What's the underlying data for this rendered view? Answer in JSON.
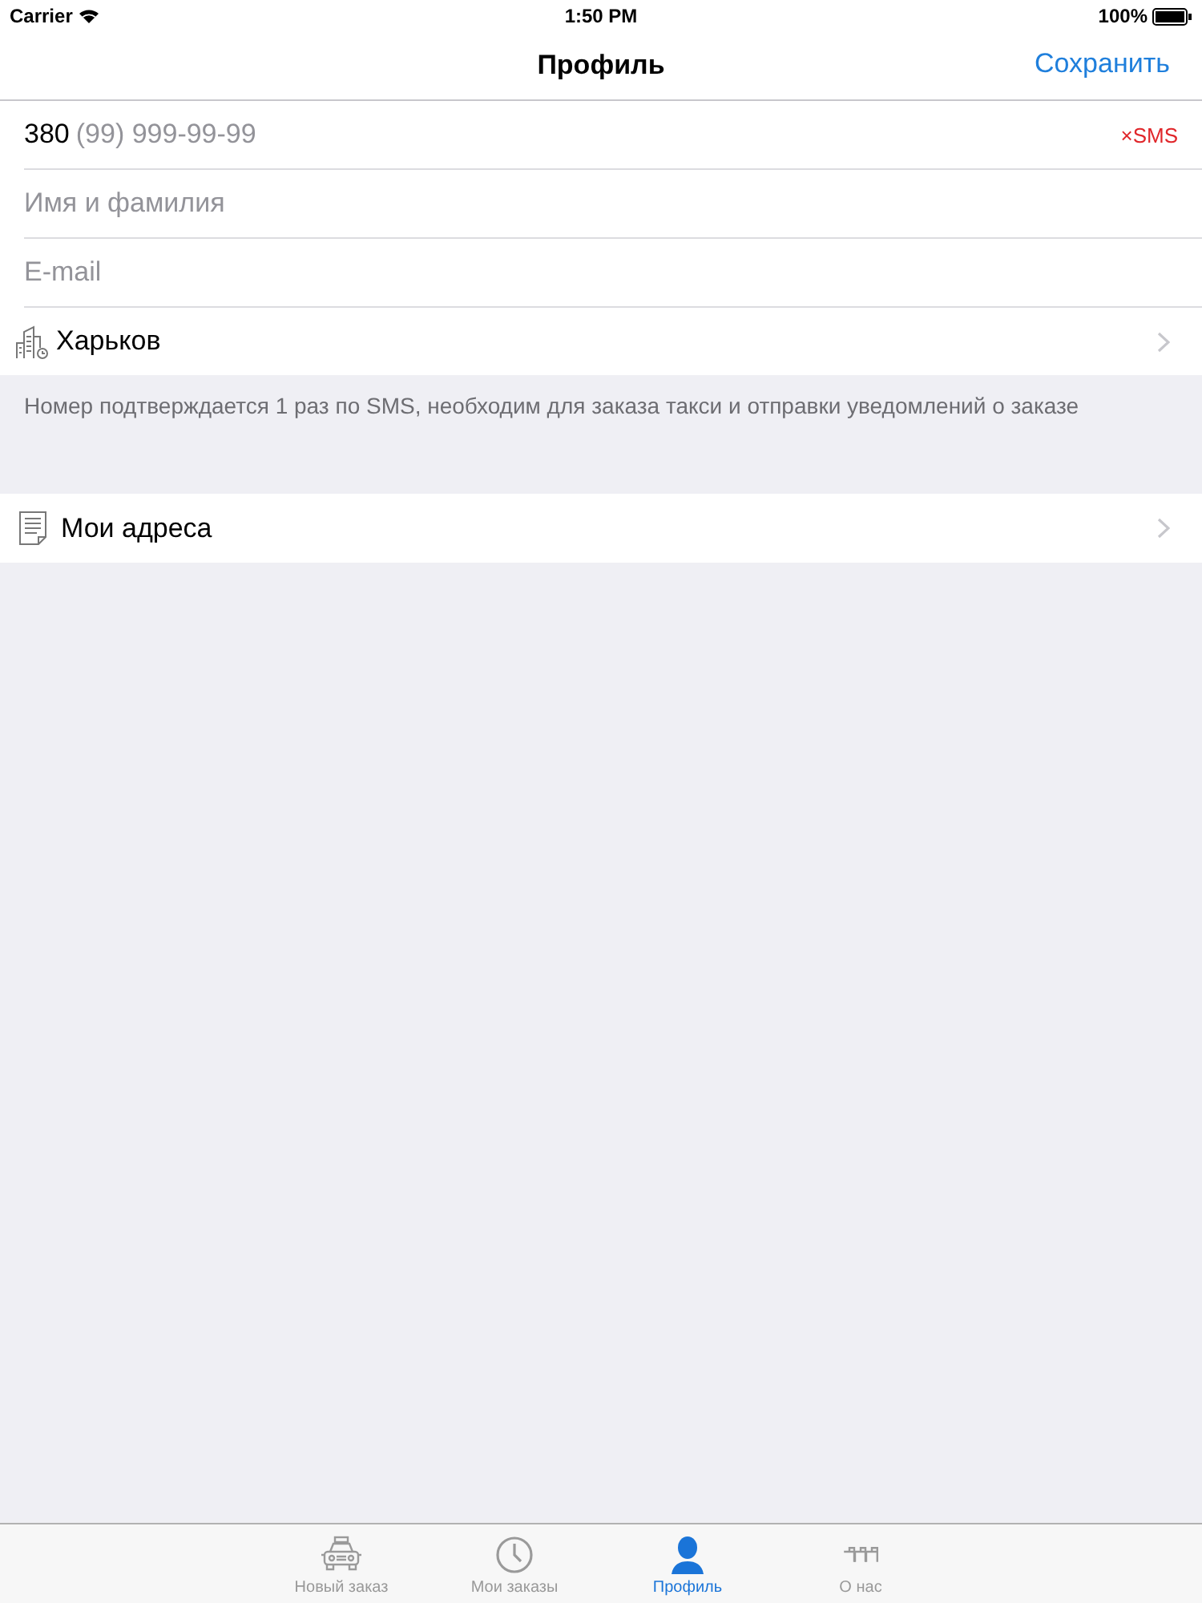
{
  "status_bar": {
    "carrier": "Carrier",
    "time": "1:50 PM",
    "battery": "100%"
  },
  "nav_bar": {
    "title": "Профиль",
    "action": "Сохранить"
  },
  "form": {
    "phone": {
      "prefix": "380",
      "placeholder": "(99) 999-99-99",
      "sms_button": "×SMS"
    },
    "fields": [
      {
        "placeholder": "Имя и фамилия"
      },
      {
        "placeholder": "E-mail"
      }
    ],
    "city": {
      "label": "Харьков"
    }
  },
  "note": "Номер подтверждается 1 раз по SMS, необходим для заказа такси и отправки уведомлений о заказе",
  "menu": [
    {
      "label": "Мои адреса"
    }
  ],
  "tab_bar": [
    {
      "label": "Новый заказ",
      "kind": "taxi",
      "selected": false
    },
    {
      "label": "Мои заказы",
      "kind": "clock",
      "selected": false
    },
    {
      "label": "Профиль",
      "kind": "person",
      "selected": true
    },
    {
      "label": "О нас",
      "kind": "checker",
      "selected": false
    }
  ]
}
